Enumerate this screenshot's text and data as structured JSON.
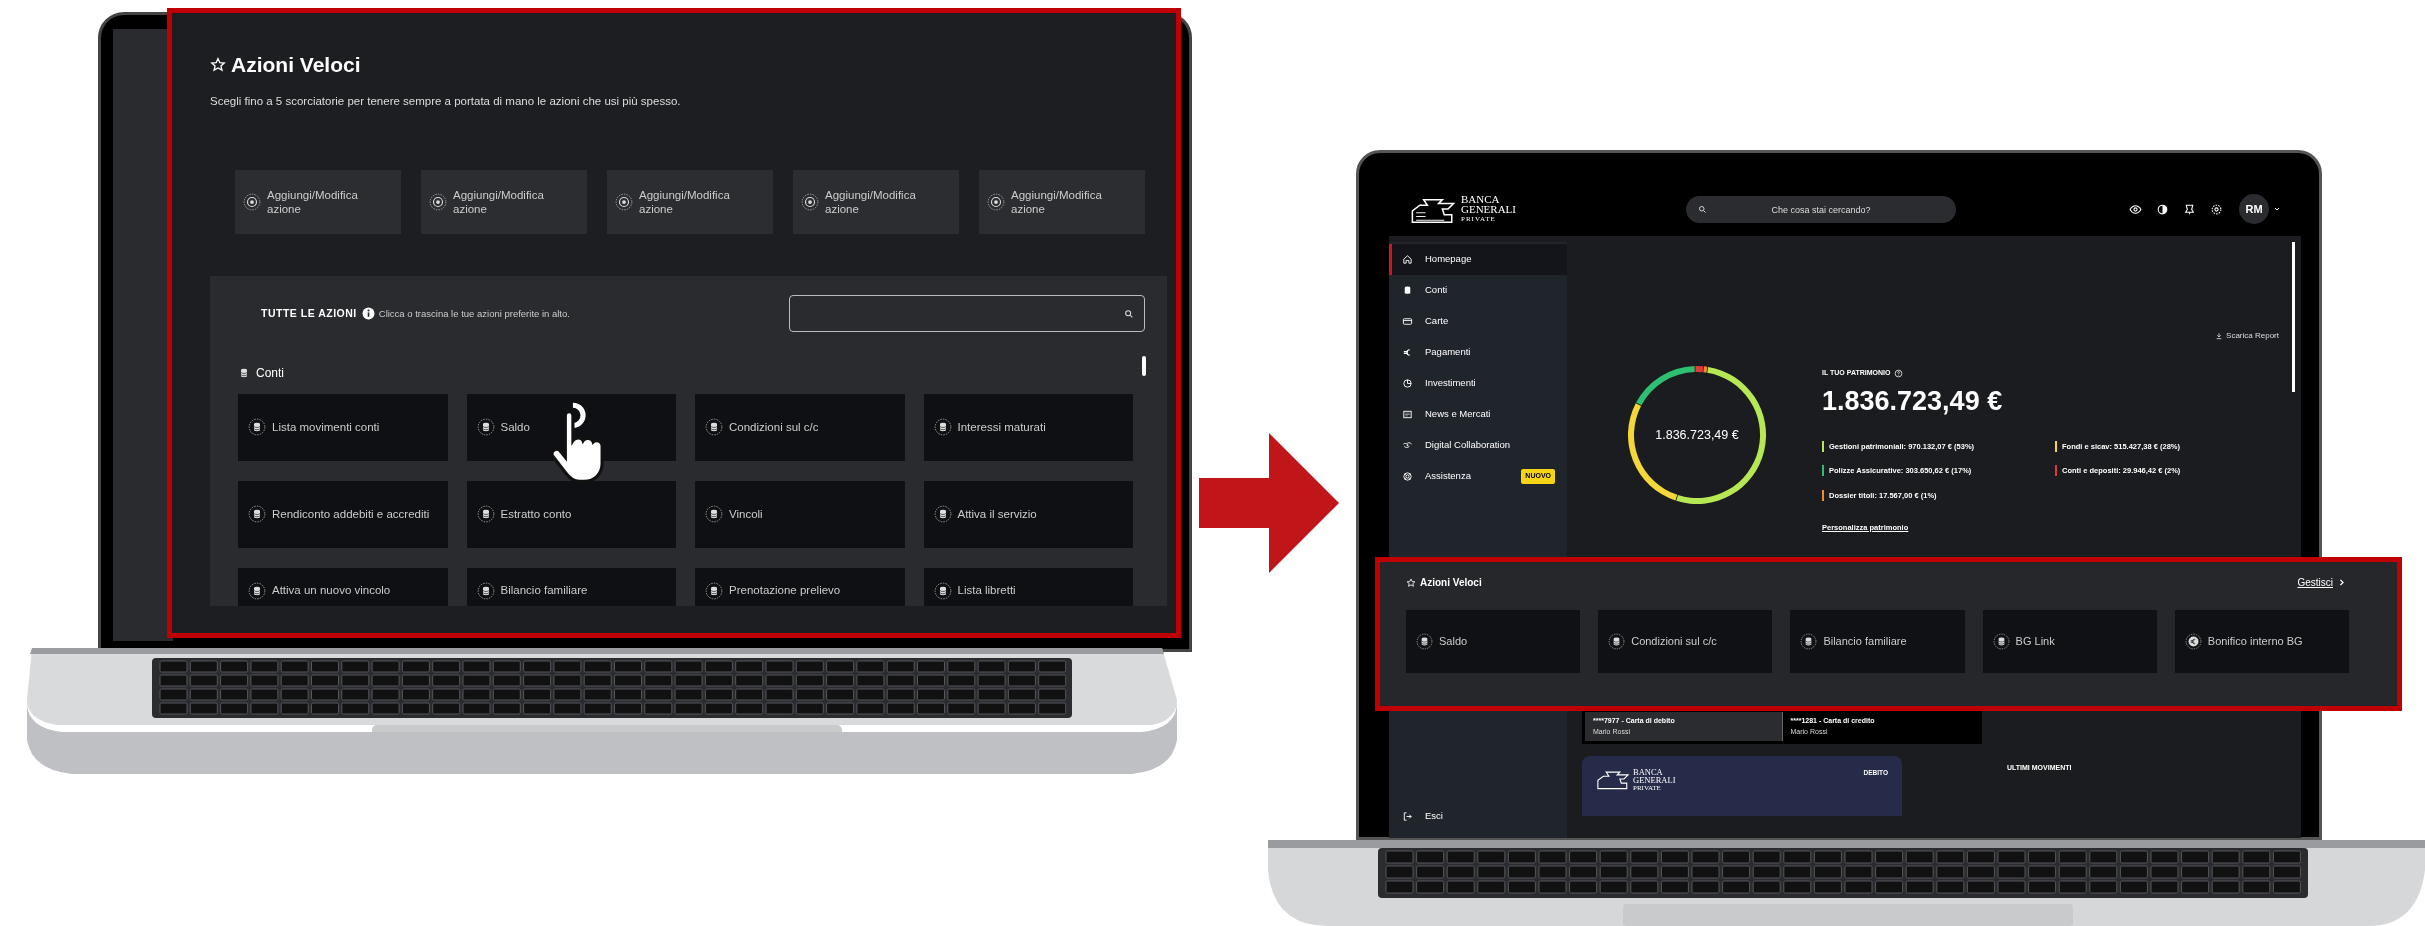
{
  "quick_actions_editor": {
    "title": "Azioni Veloci",
    "subtitle": "Scegli fino a 5 scorciatorie per tenere sempre a portata di mano le azioni che usi più spesso.",
    "slots": [
      {
        "label": "Aggiungi/Modifica azione"
      },
      {
        "label": "Aggiungi/Modifica azione"
      },
      {
        "label": "Aggiungi/Modifica azione"
      },
      {
        "label": "Aggiungi/Modifica azione"
      },
      {
        "label": "Aggiungi/Modifica azione"
      }
    ],
    "all_actions": {
      "title": "TUTTE LE AZIONI",
      "hint": "Clicca o trascina le tue azioni preferite in alto.",
      "group": "Conti",
      "actions": [
        {
          "label": "Lista movimenti conti"
        },
        {
          "label": "Saldo"
        },
        {
          "label": "Condizioni sul c/c"
        },
        {
          "label": "Interessi maturati"
        },
        {
          "label": "Rendiconto addebiti e accrediti"
        },
        {
          "label": "Estratto conto"
        },
        {
          "label": "Vincoli"
        },
        {
          "label": "Attiva il servizio"
        },
        {
          "label": "Attiva un nuovo vincolo"
        },
        {
          "label": "Bilancio familiare"
        },
        {
          "label": "Prenotazione prelievo"
        },
        {
          "label": "Lista libretti"
        }
      ]
    }
  },
  "dashboard": {
    "logo": [
      "BANCA",
      "GENERALI",
      "PRIVATE"
    ],
    "search": {
      "placeholder": "Che cosa stai cercando?"
    },
    "avatar": "RM",
    "sidebar": {
      "items": [
        {
          "label": "Homepage",
          "selected": true
        },
        {
          "label": "Conti",
          "selected": false
        },
        {
          "label": "Carte",
          "selected": false
        },
        {
          "label": "Pagamenti",
          "selected": false
        },
        {
          "label": "Investimenti",
          "selected": false
        },
        {
          "label": "News e Mercati",
          "selected": false
        },
        {
          "label": "Digital Collaboration",
          "selected": false
        },
        {
          "label": "Assistenza",
          "selected": false,
          "badge": "NUOVO"
        }
      ],
      "logout": "Esci"
    },
    "download": "Scarica Report",
    "wealth": {
      "label": "IL TUO PATRIMONIO",
      "total": "1.836.723,49 €",
      "donut_center": "1.836.723,49 €",
      "chart_data": {
        "type": "donut",
        "values": [
          53,
          28,
          17,
          2,
          1
        ]
      },
      "breakdown": [
        {
          "text": "Gestioni patrimoniali: 970.132,07 € (53%)",
          "color": "#b5e853"
        },
        {
          "text": "Fondi e sicav: 515.427,38 € (28%)",
          "color": "#f5d73a"
        },
        {
          "text": "Polizze Assicurative: 303.650,62 € (17%)",
          "color": "#2fbf71"
        },
        {
          "text": "Conti e depositi: 29.946,42 € (2%)",
          "color": "#e53935"
        },
        {
          "text": "Dossier titoli: 17.567,00 € (1%)",
          "color": "#f28c28"
        }
      ],
      "customize": "Personalizza patrimonio"
    },
    "quick_actions": {
      "title": "Azioni Veloci",
      "manage": "Gestisci",
      "actions": [
        {
          "label": "Saldo",
          "kind": "account"
        },
        {
          "label": "Condizioni sul c/c",
          "kind": "account"
        },
        {
          "label": "Bilancio familiare",
          "kind": "account"
        },
        {
          "label": "BG Link",
          "kind": "account"
        },
        {
          "label": "Bonifico interno BG",
          "kind": "payment"
        }
      ]
    },
    "cards": {
      "tabs": [
        {
          "number": "****7977 - Carta di debito",
          "holder": "Mario Rossi",
          "selected": true
        },
        {
          "number": "****1281 - Carta di credito",
          "holder": "Mario Rossi",
          "selected": false
        }
      ],
      "card": {
        "type": "DEBITO",
        "logo": [
          "BANCA",
          "GENERALI",
          "PRIVATE"
        ]
      },
      "movements_title": "ULTIMI MOVIMENTI"
    }
  }
}
